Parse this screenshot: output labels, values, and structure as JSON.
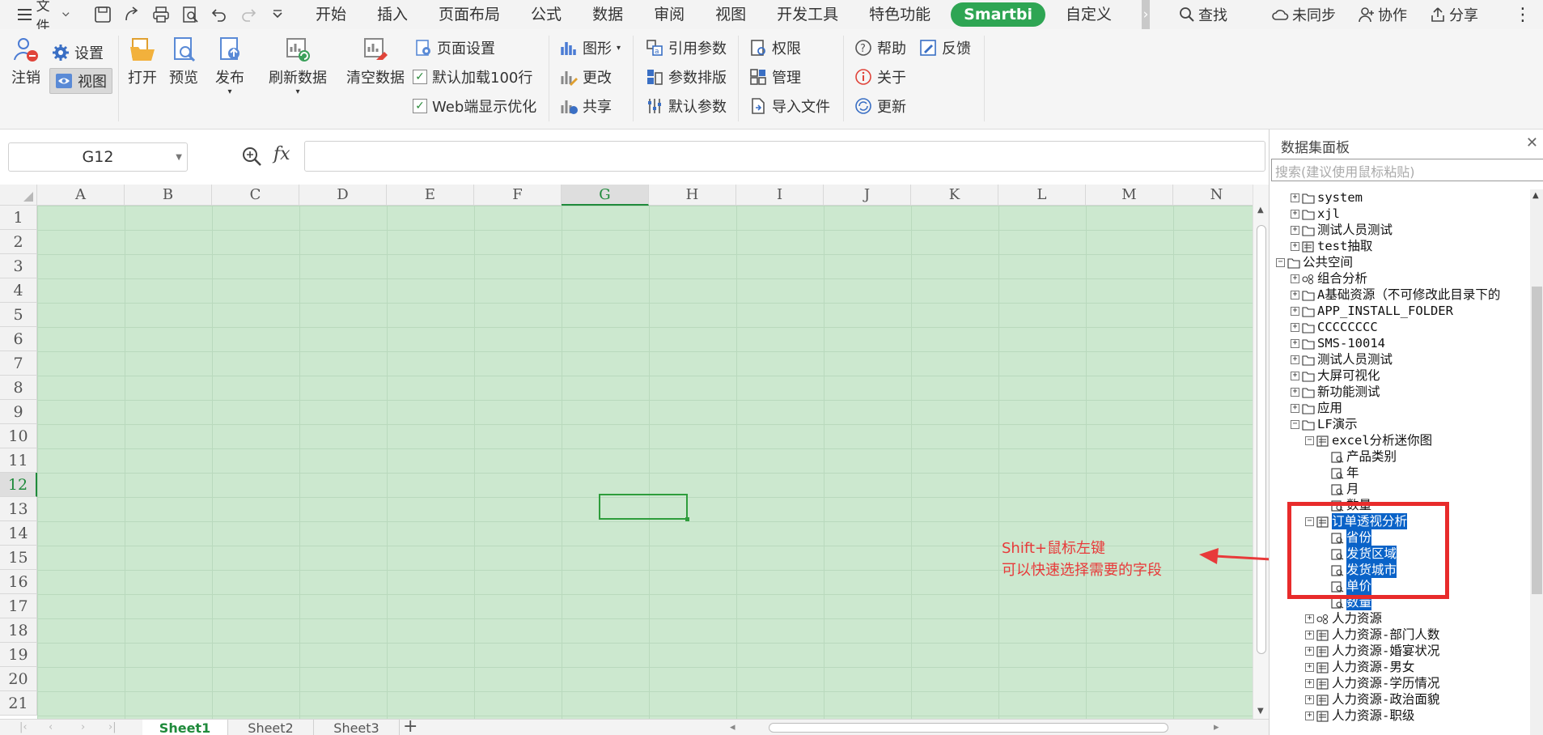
{
  "menubar": {
    "file_label": "文件",
    "tabs": [
      "开始",
      "插入",
      "页面布局",
      "公式",
      "数据",
      "审阅",
      "视图",
      "开发工具",
      "特色功能",
      "Smartbi",
      "自定义"
    ],
    "search_label": "查找",
    "unsynced_label": "未同步",
    "collab_label": "协作",
    "share_label": "分享"
  },
  "ribbon": {
    "logout": "注销",
    "settings": "设置",
    "view": "视图",
    "open": "打开",
    "preview": "预览",
    "publish": "发布",
    "refresh": "刷新数据",
    "clear": "清空数据",
    "page_setup": "页面设置",
    "default_load": "默认加载100行",
    "web_opt": "Web端显示优化",
    "chart": "图形",
    "change": "更改",
    "share": "共享",
    "ref_param": "引用参数",
    "param_layout": "参数排版",
    "default_param": "默认参数",
    "permission": "权限",
    "manage": "管理",
    "import_file": "导入文件",
    "help": "帮助",
    "feedback": "反馈",
    "about": "关于",
    "update": "更新"
  },
  "formula_bar": {
    "name_box": "G12",
    "fx": "fx"
  },
  "sheet": {
    "columns": [
      "A",
      "B",
      "C",
      "D",
      "E",
      "F",
      "G",
      "H",
      "I",
      "J",
      "K",
      "L",
      "M",
      "N"
    ],
    "rows": [
      "1",
      "2",
      "3",
      "4",
      "5",
      "6",
      "7",
      "8",
      "9",
      "10",
      "11",
      "12",
      "13",
      "14",
      "15",
      "16",
      "17",
      "18",
      "19",
      "20",
      "21"
    ],
    "active_column": "G",
    "active_row": "12",
    "tabs": [
      "Sheet1",
      "Sheet2",
      "Sheet3"
    ],
    "active_tab": "Sheet1"
  },
  "annotation": {
    "line1": "Shift+鼠标左键",
    "line2": "可以快速选择需要的字段",
    "color": "#e83a3a"
  },
  "panel": {
    "title": "数据集面板",
    "search_placeholder": "搜索(建议使用鼠标粘贴)",
    "tree": [
      {
        "label": "system",
        "level": 1,
        "exp": "+",
        "icon": "folder"
      },
      {
        "label": "xjl",
        "level": 1,
        "exp": "+",
        "icon": "folder"
      },
      {
        "label": "测试人员测试",
        "level": 1,
        "exp": "+",
        "icon": "folder"
      },
      {
        "label": "test抽取",
        "level": 1,
        "exp": "+",
        "icon": "dataset"
      },
      {
        "label": "公共空间",
        "level": 0,
        "exp": "-",
        "icon": "folder"
      },
      {
        "label": "组合分析",
        "level": 1,
        "exp": "+",
        "icon": "combo"
      },
      {
        "label": "A基础资源（不可修改此目录下的",
        "level": 1,
        "exp": "+",
        "icon": "folder"
      },
      {
        "label": "APP_INSTALL_FOLDER",
        "level": 1,
        "exp": "+",
        "icon": "folder"
      },
      {
        "label": "CCCCCCCC",
        "level": 1,
        "exp": "+",
        "icon": "folder"
      },
      {
        "label": "SMS-10014",
        "level": 1,
        "exp": "+",
        "icon": "folder"
      },
      {
        "label": "测试人员测试",
        "level": 1,
        "exp": "+",
        "icon": "folder"
      },
      {
        "label": "大屏可视化",
        "level": 1,
        "exp": "+",
        "icon": "folder"
      },
      {
        "label": "新功能测试",
        "level": 1,
        "exp": "+",
        "icon": "folder"
      },
      {
        "label": "应用",
        "level": 1,
        "exp": "+",
        "icon": "folder"
      },
      {
        "label": "LF演示",
        "level": 1,
        "exp": "-",
        "icon": "folder"
      },
      {
        "label": "excel分析迷你图",
        "level": 2,
        "exp": "-",
        "icon": "dataset"
      },
      {
        "label": "产品类别",
        "level": 3,
        "exp": "",
        "icon": "field"
      },
      {
        "label": "年",
        "level": 3,
        "exp": "",
        "icon": "field"
      },
      {
        "label": "月",
        "level": 3,
        "exp": "",
        "icon": "field"
      },
      {
        "label": "数量",
        "level": 3,
        "exp": "",
        "icon": "field"
      },
      {
        "label": "订单透视分析",
        "level": 2,
        "exp": "-",
        "icon": "dataset",
        "hl": true
      },
      {
        "label": "省份",
        "level": 3,
        "exp": "",
        "icon": "field",
        "hl": true
      },
      {
        "label": "发货区域",
        "level": 3,
        "exp": "",
        "icon": "field",
        "hl": true
      },
      {
        "label": "发货城市",
        "level": 3,
        "exp": "",
        "icon": "field",
        "hl": true
      },
      {
        "label": "单价",
        "level": 3,
        "exp": "",
        "icon": "field",
        "hl": true
      },
      {
        "label": "数量",
        "level": 3,
        "exp": "",
        "icon": "field",
        "hl": true
      },
      {
        "label": "人力资源",
        "level": 2,
        "exp": "+",
        "icon": "combo"
      },
      {
        "label": "人力资源-部门人数",
        "level": 2,
        "exp": "+",
        "icon": "dataset"
      },
      {
        "label": "人力资源-婚宴状况",
        "level": 2,
        "exp": "+",
        "icon": "dataset"
      },
      {
        "label": "人力资源-男女",
        "level": 2,
        "exp": "+",
        "icon": "dataset"
      },
      {
        "label": "人力资源-学历情况",
        "level": 2,
        "exp": "+",
        "icon": "dataset"
      },
      {
        "label": "人力资源-政治面貌",
        "level": 2,
        "exp": "+",
        "icon": "dataset"
      },
      {
        "label": "人力资源-职级",
        "level": 2,
        "exp": "+",
        "icon": "dataset"
      }
    ]
  }
}
